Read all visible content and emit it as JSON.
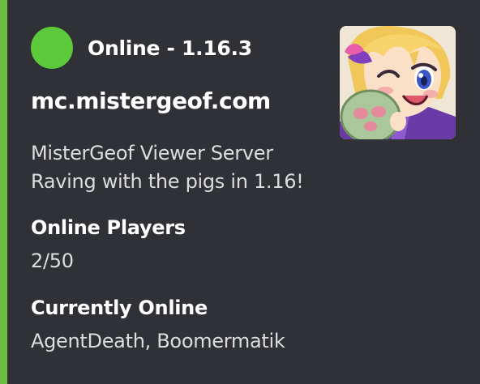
{
  "embed": {
    "accent_color": "#6fbd3f",
    "author": {
      "status_color": "#5cc93a",
      "name": "Online - 1.16.3"
    },
    "title": "mc.mistergeof.com",
    "description_lines": [
      "MisterGeof Viewer Server",
      "Raving with the pigs in 1.16!"
    ],
    "fields": [
      {
        "name": "Online Players",
        "value": "2/50"
      },
      {
        "name": "Currently Online",
        "value": "AgentDeath, Boomermatik"
      }
    ],
    "thumbnail": {
      "icon": "anime-avatar-winking-icon"
    }
  }
}
